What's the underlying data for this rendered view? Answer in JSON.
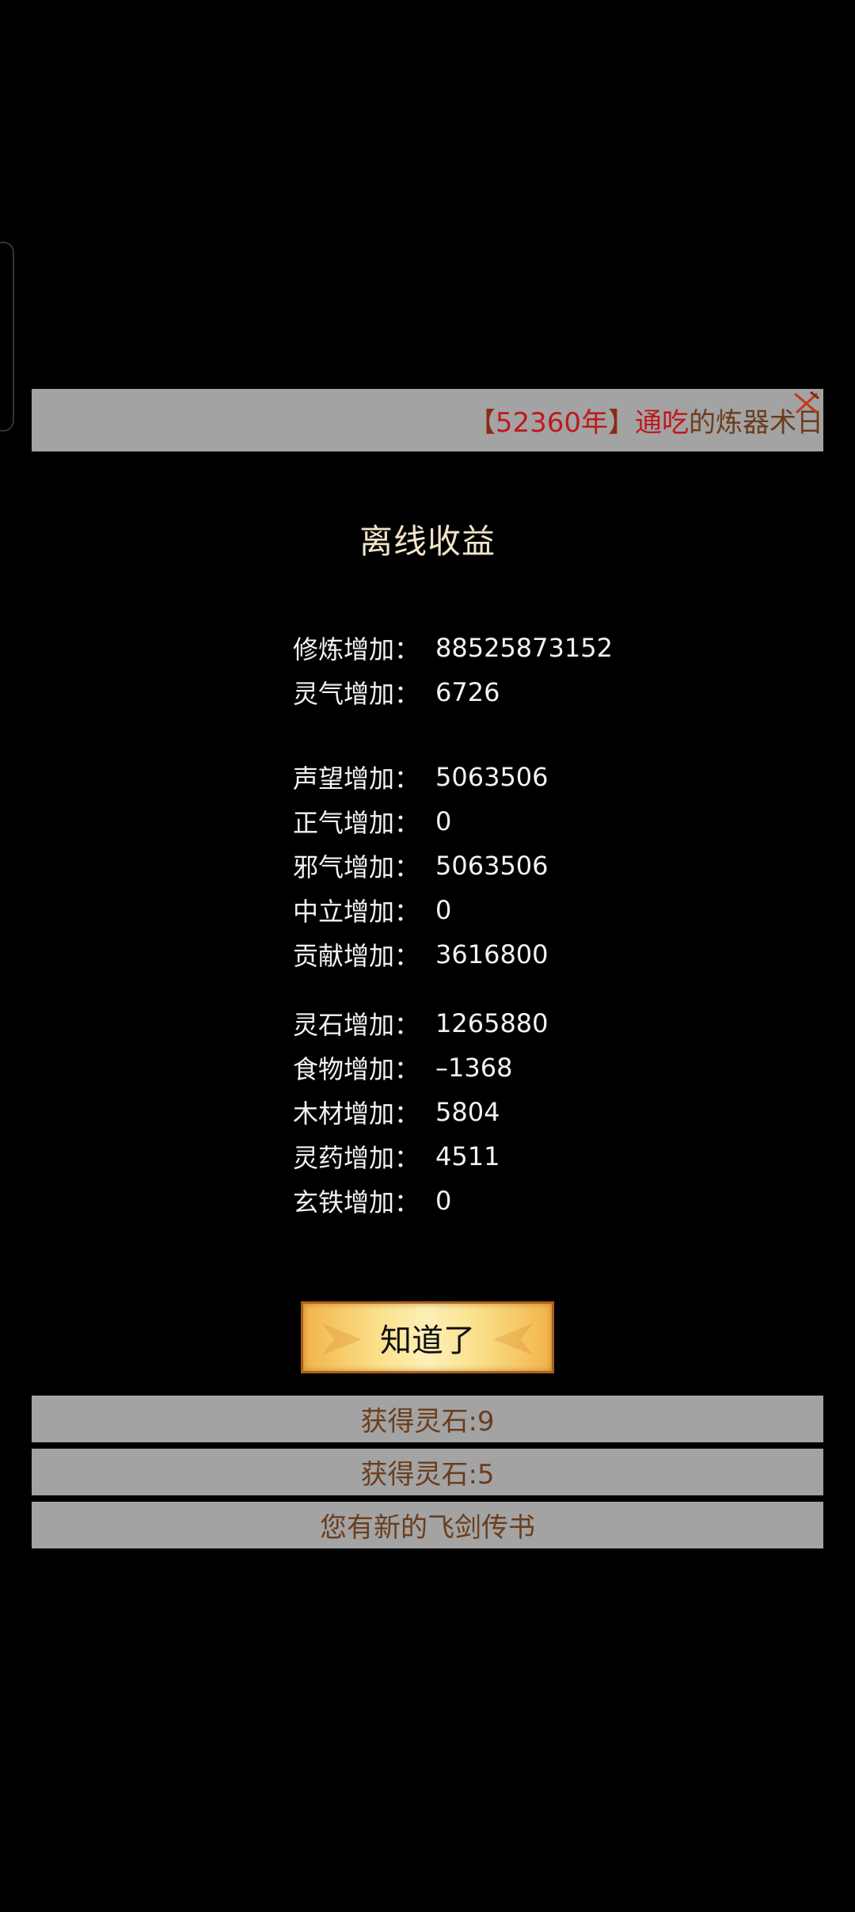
{
  "ticker": {
    "open_bracket": "【 ",
    "year": "52360年",
    "close_bracket": " 】",
    "person": "通吃",
    "event": "的炼器术日"
  },
  "title": "离线收益",
  "stats_group1": [
    {
      "label": "修炼增加：",
      "value": "88525873152"
    },
    {
      "label": "灵气增加：",
      "value": "6726"
    }
  ],
  "stats_group2": [
    {
      "label": "声望增加：",
      "value": "5063506"
    },
    {
      "label": "正气增加：",
      "value": "0"
    },
    {
      "label": "邪气增加：",
      "value": "5063506"
    },
    {
      "label": "中立增加：",
      "value": "0"
    },
    {
      "label": "贡献增加：",
      "value": "3616800"
    }
  ],
  "stats_group3": [
    {
      "label": "灵石增加：",
      "value": "1265880"
    },
    {
      "label": "食物增加：",
      "value": "–1368"
    },
    {
      "label": "木材增加：",
      "value": "5804"
    },
    {
      "label": "灵药增加：",
      "value": "4511"
    },
    {
      "label": "玄铁增加：",
      "value": "0"
    }
  ],
  "ok_button": "知道了",
  "notices": [
    "获得灵石:9",
    "获得灵石:5",
    "您有新的飞剑传书"
  ],
  "icons": {
    "ticker_close": "crossed-swords-icon"
  },
  "colors": {
    "panel_bg": "#a3a3a3",
    "accent_red": "#c0181c",
    "text_brown": "#6b3d1e",
    "button_gold": "#fbe08a"
  }
}
